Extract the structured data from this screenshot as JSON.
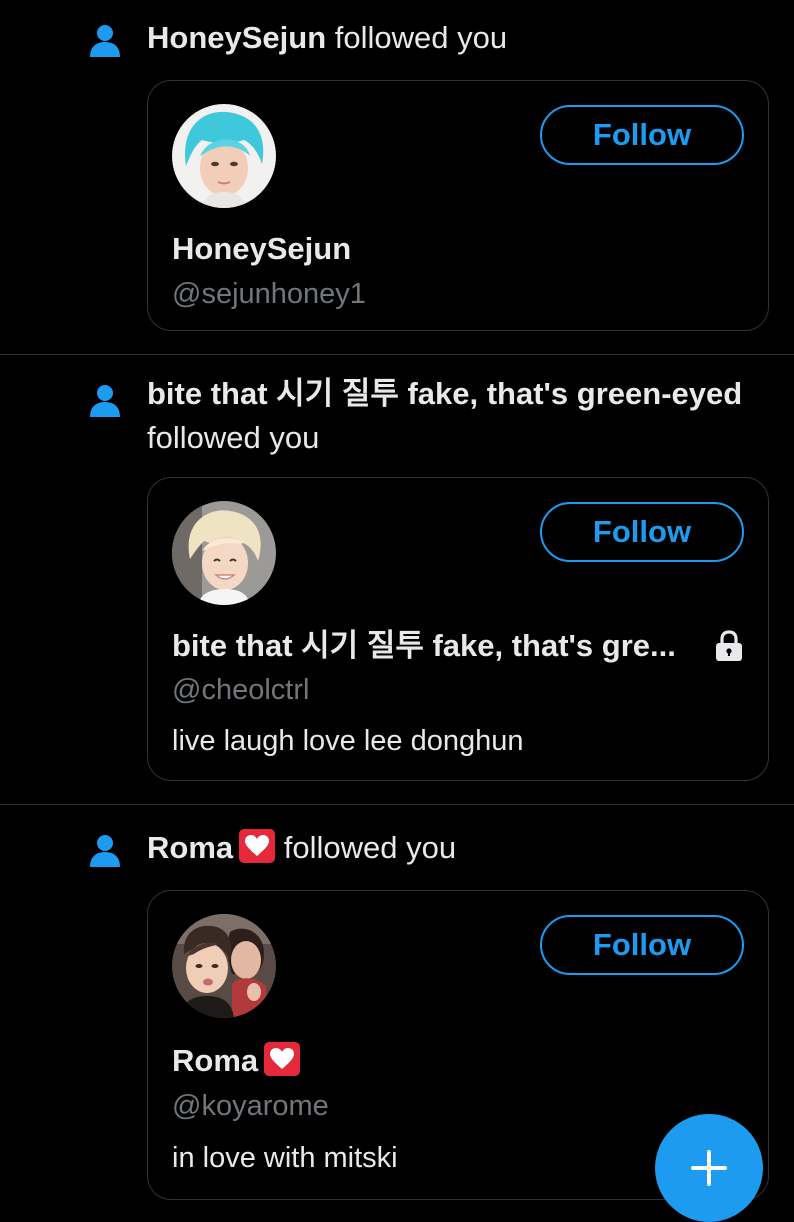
{
  "notifications": [
    {
      "header_name": "HoneySejun",
      "header_action": "followed you",
      "display_name": "HoneySejun",
      "handle": "@sejunhoney1",
      "bio": "",
      "follow_label": "Follow",
      "avatar_icon": "avatar-cyan-hair",
      "protected": false
    },
    {
      "header_name": "bite that 시기 질투 fake, that's green-eyed",
      "header_action": "followed you",
      "display_name": "bite that 시기 질투 fake, that's gre...",
      "handle": "@cheolctrl",
      "bio": "live laugh love lee donghun",
      "follow_label": "Follow",
      "avatar_icon": "avatar-blond-hair",
      "protected": true,
      "protected_icon": "lock-icon"
    },
    {
      "header_name": "Roma",
      "header_action": "followed you",
      "display_name": "Roma",
      "handle": "@koyarome",
      "bio": "in love with mitski",
      "follow_label": "Follow",
      "avatar_icon": "avatar-two-people",
      "name_emoji": "white-heart-emoji",
      "protected": false
    }
  ],
  "fab": {
    "icon": "plus-icon"
  },
  "colors": {
    "background": "#000000",
    "accent": "#1d9bf0",
    "text_primary": "#e7e9ea",
    "text_secondary": "#71767b",
    "border": "#2f3336",
    "heart_badge": "#e5293a"
  }
}
